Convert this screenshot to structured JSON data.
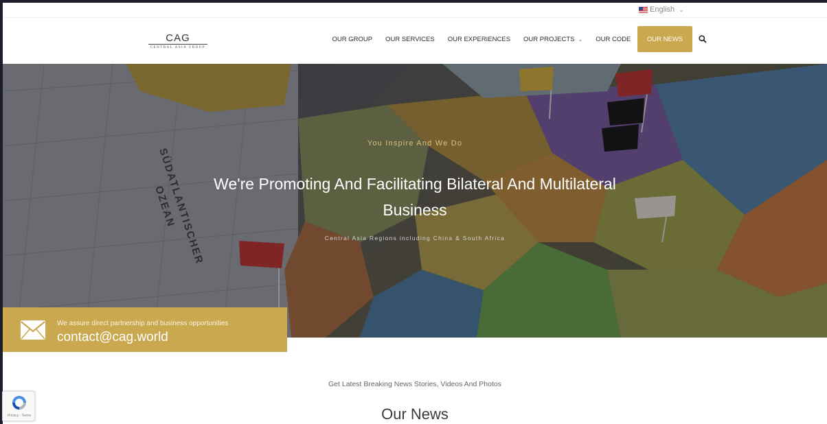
{
  "language": {
    "selected": "English",
    "icon": "us-flag-icon"
  },
  "brand": {
    "logo_main": "CAG",
    "logo_sub": "CENTRAL ASIA GROUP"
  },
  "nav": {
    "items": [
      {
        "label": "OUR GROUP"
      },
      {
        "label": "OUR SERVICES"
      },
      {
        "label": "OUR EXPERIENCES"
      },
      {
        "label": "OUR PROJECTS"
      },
      {
        "label": "OUR CODE"
      },
      {
        "label": "OUR NEWS"
      }
    ],
    "active": "OUR NEWS",
    "search_icon": "search-icon"
  },
  "hero": {
    "kicker": "You Inspire And We Do",
    "title": "We're Promoting And Facilitating Bilateral And Multilateral Business",
    "subtitle": "Central Asia Regions including China & South Africa",
    "map_labels": [
      "SÜDATLANTISCHER",
      "OZEAN"
    ]
  },
  "contact": {
    "note": "We assure direct partnership and business opportunities",
    "email": "contact@cag.world",
    "icon": "envelope-icon"
  },
  "news": {
    "kicker": "Get Latest Breaking News Stories, Videos And Photos",
    "title": "Our News"
  },
  "recaptcha": {
    "text": "Privacy - Terms"
  },
  "colors": {
    "accent": "#c9a84f",
    "text_dark": "#2b2b2b",
    "page_bg": "#ffffff"
  }
}
